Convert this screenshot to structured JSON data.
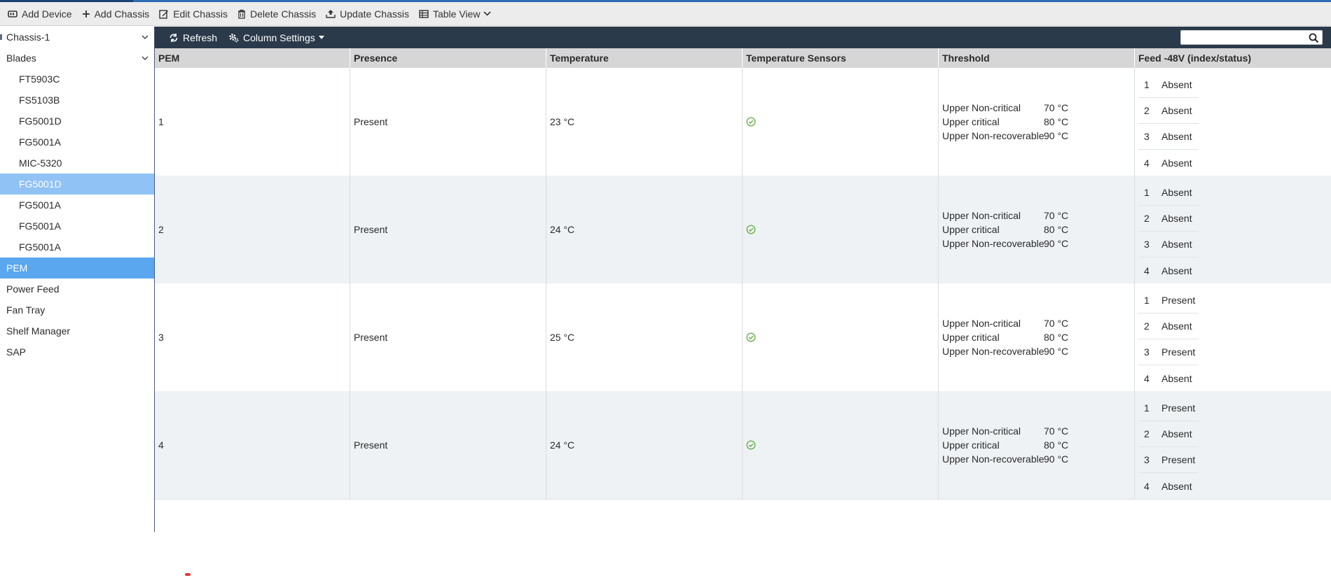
{
  "toolbar": {
    "items": [
      {
        "label": "Add Device",
        "icon": "add-device-icon"
      },
      {
        "label": "Add Chassis",
        "icon": "plus-icon"
      },
      {
        "label": "Edit Chassis",
        "icon": "edit-icon"
      },
      {
        "label": "Delete Chassis",
        "icon": "trash-icon"
      },
      {
        "label": "Update Chassis",
        "icon": "upload-icon"
      },
      {
        "label": "Table View",
        "icon": "table-icon"
      }
    ]
  },
  "sidebar": {
    "items": [
      {
        "label": "Chassis-1"
      },
      {
        "label": "Blades"
      },
      {
        "label": "FT5903C"
      },
      {
        "label": "FS5103B"
      },
      {
        "label": "FG5001D"
      },
      {
        "label": "FG5001A"
      },
      {
        "label": "MIC-5320"
      },
      {
        "label": "FG5001D"
      },
      {
        "label": "FG5001A"
      },
      {
        "label": "FG5001A"
      },
      {
        "label": "FG5001A"
      },
      {
        "label": "PEM"
      },
      {
        "label": "Power Feed"
      },
      {
        "label": "Fan Tray"
      },
      {
        "label": "Shelf Manager"
      },
      {
        "label": "SAP"
      }
    ]
  },
  "content_toolbar": {
    "refresh_label": "Refresh",
    "column_settings_label": "Column Settings",
    "search_placeholder": ""
  },
  "table": {
    "headers": [
      "PEM",
      "Presence",
      "Temperature",
      "Temperature Sensors",
      "Threshold",
      "Feed -48V (index/status)"
    ],
    "rows": [
      {
        "pem": "1",
        "presence": "Present",
        "temperature": "23 °C",
        "thresholds": [
          {
            "label": "Upper Non-critical",
            "value": "70 °C"
          },
          {
            "label": "Upper critical",
            "value": "80 °C"
          },
          {
            "label": "Upper Non-recoverable",
            "value": "90 °C"
          }
        ],
        "feeds": [
          {
            "index": "1",
            "status": "Absent"
          },
          {
            "index": "2",
            "status": "Absent"
          },
          {
            "index": "3",
            "status": "Absent"
          },
          {
            "index": "4",
            "status": "Absent"
          }
        ]
      },
      {
        "pem": "2",
        "presence": "Present",
        "temperature": "24 °C",
        "thresholds": [
          {
            "label": "Upper Non-critical",
            "value": "70 °C"
          },
          {
            "label": "Upper critical",
            "value": "80 °C"
          },
          {
            "label": "Upper Non-recoverable",
            "value": "90 °C"
          }
        ],
        "feeds": [
          {
            "index": "1",
            "status": "Absent"
          },
          {
            "index": "2",
            "status": "Absent"
          },
          {
            "index": "3",
            "status": "Absent"
          },
          {
            "index": "4",
            "status": "Absent"
          }
        ]
      },
      {
        "pem": "3",
        "presence": "Present",
        "temperature": "25 °C",
        "thresholds": [
          {
            "label": "Upper Non-critical",
            "value": "70 °C"
          },
          {
            "label": "Upper critical",
            "value": "80 °C"
          },
          {
            "label": "Upper Non-recoverable",
            "value": "90 °C"
          }
        ],
        "feeds": [
          {
            "index": "1",
            "status": "Present"
          },
          {
            "index": "2",
            "status": "Absent"
          },
          {
            "index": "3",
            "status": "Present"
          },
          {
            "index": "4",
            "status": "Absent"
          }
        ]
      },
      {
        "pem": "4",
        "presence": "Present",
        "temperature": "24 °C",
        "thresholds": [
          {
            "label": "Upper Non-critical",
            "value": "70 °C"
          },
          {
            "label": "Upper critical",
            "value": "80 °C"
          },
          {
            "label": "Upper Non-recoverable",
            "value": "90 °C"
          }
        ],
        "feeds": [
          {
            "index": "1",
            "status": "Present"
          },
          {
            "index": "2",
            "status": "Absent"
          },
          {
            "index": "3",
            "status": "Present"
          },
          {
            "index": "4",
            "status": "Absent"
          }
        ]
      }
    ]
  },
  "colors": {
    "accent": "#2d6cb5",
    "toolbar_dark": "#2b3a4a",
    "selected_dark": "#5aa7ef",
    "selected_light": "#90c2f5",
    "sensor_ok": "#6ab04c"
  }
}
